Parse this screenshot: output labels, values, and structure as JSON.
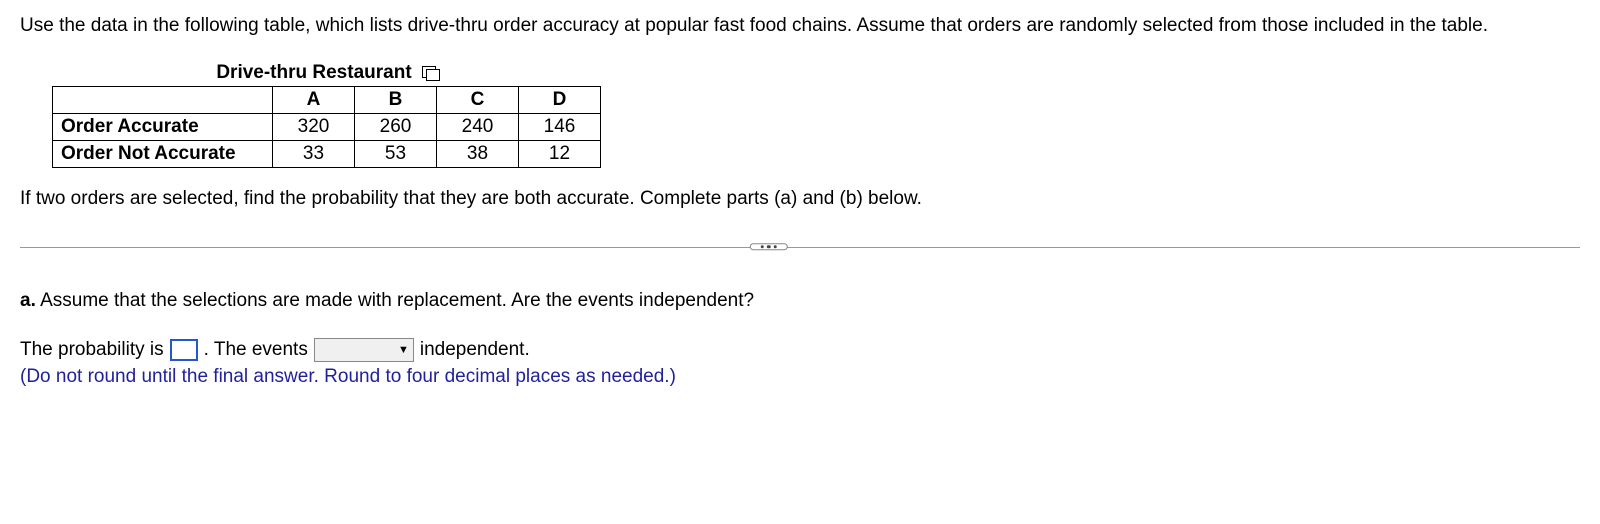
{
  "intro": "Use the data in the following table, which lists drive-thru order accuracy at popular fast food chains. Assume that orders are randomly selected from those included in the table.",
  "table": {
    "title": "Drive-thru Restaurant",
    "columns": [
      "A",
      "B",
      "C",
      "D"
    ],
    "rows": [
      {
        "label": "Order Accurate",
        "values": [
          320,
          260,
          240,
          146
        ]
      },
      {
        "label": "Order Not Accurate",
        "values": [
          33,
          53,
          38,
          12
        ]
      }
    ]
  },
  "question_after_table": "If two orders are selected, find the probability that they are both accurate. Complete parts (a) and (b) below.",
  "part_a": {
    "prefix": "a.",
    "text": "Assume that the selections are made with replacement. Are the events independent?"
  },
  "answer_line": {
    "lead": "The probability is",
    "after_input": ". The events",
    "after_select": "independent."
  },
  "hint": "(Do not round until the final answer. Round to four decimal places as needed.)",
  "chart_data": {
    "type": "table",
    "title": "Drive-thru Restaurant",
    "columns": [
      "",
      "A",
      "B",
      "C",
      "D"
    ],
    "rows": [
      [
        "Order Accurate",
        320,
        260,
        240,
        146
      ],
      [
        "Order Not Accurate",
        33,
        53,
        38,
        12
      ]
    ]
  }
}
